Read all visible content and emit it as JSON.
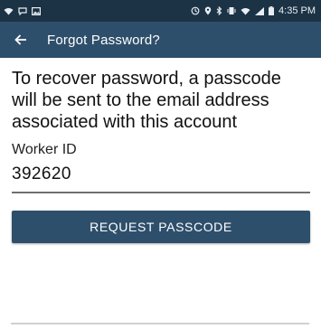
{
  "status_bar": {
    "time": "4:35 PM",
    "left_icons": [
      "wifi-icon",
      "message-icon",
      "image-icon"
    ],
    "right_icons": [
      "sync-icon",
      "location-icon",
      "bluetooth-icon",
      "vibrate-icon",
      "wifi-signal-icon",
      "cell-signal-icon",
      "battery-icon"
    ]
  },
  "app_bar": {
    "title": "Forgot Password?",
    "back_icon": "arrow-left-icon"
  },
  "main": {
    "description": "To recover password, a passcode will be sent to the email address associated with this account",
    "worker_id_label": "Worker ID",
    "worker_id_value": "392620",
    "request_button_label": "REQUEST PASSCODE"
  },
  "colors": {
    "status_bar_bg": "#1c3245",
    "primary": "#2e4f6b",
    "text": "#111111"
  }
}
